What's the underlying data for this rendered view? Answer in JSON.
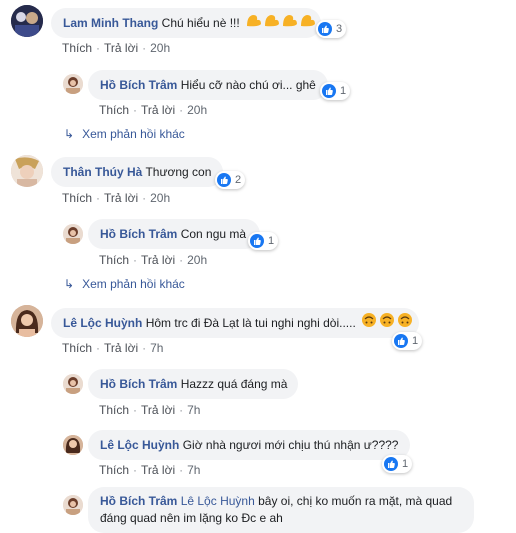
{
  "labels": {
    "like": "Thích",
    "reply": "Trả lời"
  },
  "comments": [
    {
      "author": "Lam Minh Thang",
      "text": "Chú hiểu nè !!!",
      "time": "20h",
      "reactions": "3"
    },
    {
      "author": "Hồ Bích Trâm",
      "text": "Hiểu cỡ nào chú ơi... ghê",
      "time": "20h",
      "reactions": "1"
    },
    {
      "more": "Xem phản hồi khác"
    },
    {
      "author": "Thân Thúy Hà",
      "text": "Thương con",
      "time": "20h",
      "reactions": "2"
    },
    {
      "author": "Hồ Bích Trâm",
      "text": "Con ngu mà",
      "time": "20h",
      "reactions": "1"
    },
    {
      "more": "Xem phản hồi khác"
    },
    {
      "author": "Lê Lộc Huỳnh",
      "text": "Hôm trc đi Đà Lạt là tui nghi nghi dòi.....",
      "time": "7h",
      "reactions": "1"
    },
    {
      "author": "Hồ Bích Trâm",
      "text": "Hazzz quá đáng mà",
      "time": "7h"
    },
    {
      "author": "Lê Lộc Huỳnh",
      "text": "Giờ nhà ngươi mới chịu thú nhận ư????",
      "time": "7h",
      "reactions": "1"
    },
    {
      "author": "Hồ Bích Trâm",
      "tag": "Lê Lộc Huỳnh",
      "text_line1": "bây oi, chị ko muốn ra mặt, mà quad",
      "text_line2": "đáng quad nên im lặng ko Đc e ah"
    }
  ],
  "colors": {
    "name": "#385898",
    "bubble": "#f2f3f5",
    "like": "#1877f2",
    "emoji": "#f7b125"
  },
  "icons": {
    "like": "thumbs-up-icon",
    "flex": "flexed-biceps-emoji",
    "sad": "upside-down-face-emoji",
    "reply_arrow": "reply-arrow-icon"
  }
}
